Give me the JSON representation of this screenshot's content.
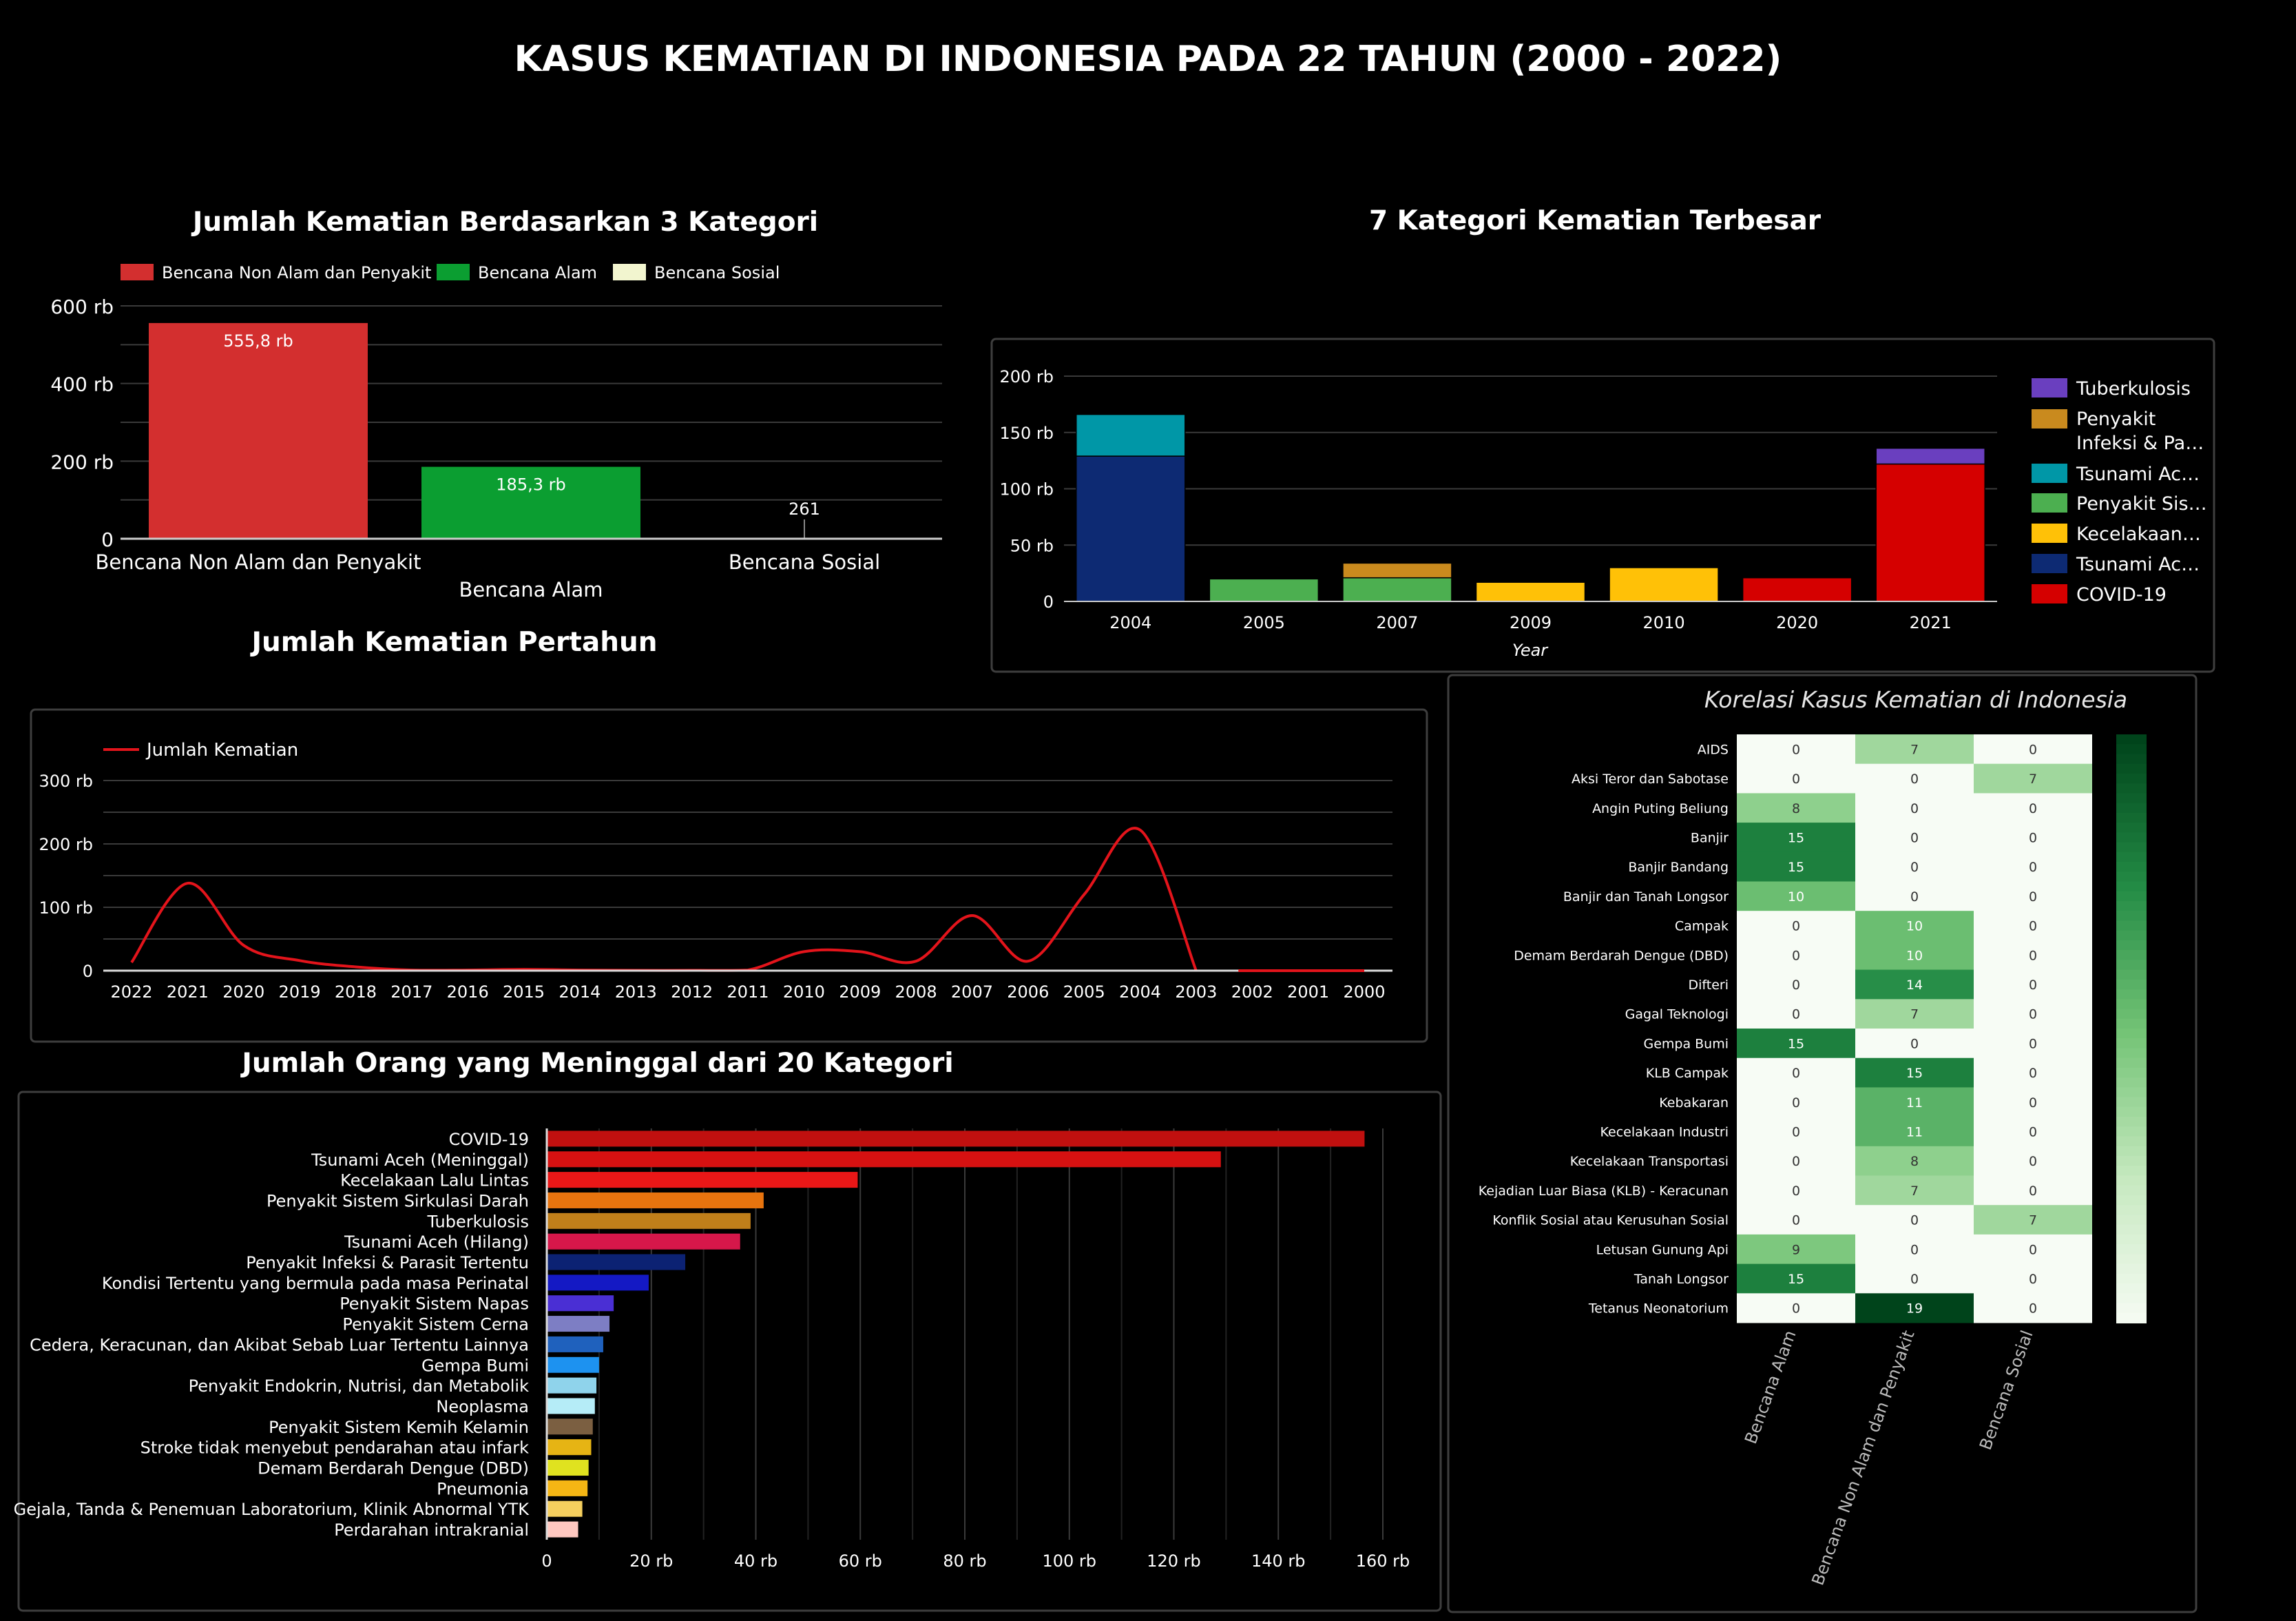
{
  "page_title": "KASUS KEMATIAN DI INDONESIA PADA 22 TAHUN (2000 - 2022)",
  "chart_data": [
    {
      "id": "kategori3",
      "type": "bar",
      "title": "Jumlah Kematian Berdasarkan 3 Kategori",
      "categories": [
        "Bencana Non Alam dan Penyakit",
        "Bencana Alam",
        "Bencana Sosial"
      ],
      "values": [
        555800,
        185300,
        261
      ],
      "value_labels": [
        "555,8 rb",
        "185,3 rb",
        "261"
      ],
      "colors": [
        "#d32f2f",
        "#0b9e31",
        "#f2f5cf"
      ],
      "legend": [
        "Bencana Non Alam dan Penyakit",
        "Bencana Alam",
        "Bencana Sosial"
      ],
      "legend_position": "top-left",
      "ylim": [
        0,
        600000
      ],
      "y_ticks": [
        0,
        200000,
        400000,
        600000
      ],
      "y_tick_labels": [
        "0",
        "200 rb",
        "400 rb",
        "600 rb"
      ],
      "grid": true
    },
    {
      "id": "top7",
      "type": "bar",
      "stacked": true,
      "title": "7 Kategori Kematian Terbesar",
      "xlabel": "Year",
      "categories": [
        "2004",
        "2005",
        "2007",
        "2009",
        "2010",
        "2020",
        "2021"
      ],
      "series": [
        {
          "name": "Tuberkulosis",
          "color": "#6a3fbf",
          "values": [
            0,
            0,
            0,
            0,
            0,
            0,
            14000
          ]
        },
        {
          "name": "Penyakit Infeksi & Pa…",
          "color": "#c98a1e",
          "values": [
            0,
            0,
            13000,
            0,
            0,
            0,
            0
          ]
        },
        {
          "name": "Tsunami Ac…",
          "color": "#0097a7",
          "values": [
            37000,
            0,
            0,
            0,
            0,
            0,
            0
          ]
        },
        {
          "name": "Penyakit Sis…",
          "color": "#4caf50",
          "values": [
            0,
            20000,
            21000,
            0,
            0,
            0,
            0
          ]
        },
        {
          "name": "Kecelakaan…",
          "color": "#ffc107",
          "values": [
            0,
            0,
            0,
            17000,
            30000,
            0,
            0
          ]
        },
        {
          "name": "Tsunami Ac…",
          "color": "#0d2a73",
          "values": [
            129000,
            0,
            0,
            0,
            0,
            0,
            0
          ]
        },
        {
          "name": "COVID-19",
          "color": "#d50000",
          "values": [
            0,
            0,
            0,
            0,
            0,
            21000,
            122000
          ]
        }
      ],
      "legend_order": [
        0,
        1,
        2,
        3,
        4,
        5,
        6
      ],
      "legend_position": "right",
      "ylim": [
        0,
        200000
      ],
      "y_ticks": [
        0,
        50000,
        100000,
        150000,
        200000
      ],
      "y_tick_labels": [
        "0",
        "50 rb",
        "100 rb",
        "150 rb",
        "200 rb"
      ],
      "grid": true
    },
    {
      "id": "pertahun",
      "type": "line",
      "title": "Jumlah Kematian Pertahun",
      "legend": [
        "Jumlah Kematian"
      ],
      "series": [
        {
          "name": "Jumlah Kematian",
          "color": "#e3141b"
        }
      ],
      "x": [
        "2022",
        "2021",
        "2020",
        "2019",
        "2018",
        "2017",
        "2016",
        "2015",
        "2014",
        "2013",
        "2012",
        "2011",
        "2010",
        "2009",
        "2008",
        "2007",
        "2006",
        "2005",
        "2004",
        "2003",
        "2002",
        "2001",
        "2000"
      ],
      "values": [
        13000,
        138000,
        40000,
        16000,
        6000,
        1000,
        1000,
        2000,
        1000,
        500,
        500,
        1000,
        30000,
        30000,
        15000,
        87000,
        15000,
        120000,
        222000,
        0,
        null,
        null,
        null
      ],
      "ylim": [
        0,
        300000
      ],
      "y_ticks": [
        0,
        100000,
        200000,
        300000
      ],
      "y_tick_labels": [
        "0",
        "100 rb",
        "200 rb",
        "300 rb"
      ],
      "grid": true
    },
    {
      "id": "kategori20",
      "type": "bar",
      "orientation": "horizontal",
      "title": "Jumlah Orang yang Meninggal dari 20 Kategori",
      "categories": [
        "COVID-19",
        "Tsunami Aceh (Meninggal)",
        "Kecelakaan Lalu Lintas",
        "Penyakit Sistem Sirkulasi Darah",
        "Tuberkulosis",
        "Tsunami Aceh (Hilang)",
        "Penyakit Infeksi & Parasit Tertentu",
        "Kondisi Tertentu yang bermula pada masa Perinatal",
        "Penyakit Sistem Napas",
        "Penyakit Sistem Cerna",
        "Cedera, Keracunan, dan Akibat Sebab Luar Tertentu Lainnya",
        "Gempa Bumi",
        "Penyakit Endokrin, Nutrisi, dan Metabolik",
        "Neoplasma",
        "Penyakit Sistem Kemih Kelamin",
        "Stroke tidak menyebut pendarahan atau infark",
        "Demam Berdarah Dengue (DBD)",
        "Pneumonia",
        "Gejala, Tanda & Penemuan Laboratorium, Klinik Abnormal YTK",
        "Perdarahan intrakranial"
      ],
      "values": [
        156500,
        129000,
        59500,
        41500,
        39000,
        37000,
        26500,
        19500,
        12800,
        12000,
        10800,
        10000,
        9500,
        9200,
        8800,
        8500,
        8000,
        7800,
        6800,
        6000
      ],
      "colors": [
        "#c0100f",
        "#d61111",
        "#ea1717",
        "#e8740e",
        "#c07f1a",
        "#d6174a",
        "#0c2273",
        "#1419c4",
        "#4a2fd4",
        "#7d7ec4",
        "#1f61bd",
        "#1d92f0",
        "#8fd3eb",
        "#b5ecf7",
        "#7b5f41",
        "#e6b414",
        "#e0e21f",
        "#f5b614",
        "#f5cf5e",
        "#ffc8c0"
      ],
      "xlim": [
        0,
        160000
      ],
      "x_ticks": [
        0,
        20000,
        40000,
        60000,
        80000,
        100000,
        120000,
        140000,
        160000
      ],
      "x_tick_labels": [
        "0",
        "20 rb",
        "40 rb",
        "60 rb",
        "80 rb",
        "100 rb",
        "120 rb",
        "140 rb",
        "160 rb"
      ],
      "grid": true
    },
    {
      "id": "korelasi",
      "type": "heatmap",
      "title": "Korelasi Kasus Kematian di Indonesia",
      "rows": [
        "AIDS",
        "Aksi Teror dan Sabotase",
        "Angin Puting Beliung",
        "Banjir",
        "Banjir Bandang",
        "Banjir dan Tanah Longsor",
        "Campak",
        "Demam Berdarah Dengue (DBD)",
        "Difteri",
        "Gagal Teknologi",
        "Gempa Bumi",
        "KLB Campak",
        "Kebakaran",
        "Kecelakaan Industri",
        "Kecelakaan Transportasi",
        "Kejadian Luar Biasa (KLB) - Keracunan",
        "Konflik Sosial atau Kerusuhan Sosial",
        "Letusan Gunung Api",
        "Tanah Longsor",
        "Tetanus Neonatorium"
      ],
      "columns": [
        "Bencana Alam",
        "Bencana Non Alam dan Penyakit",
        "Bencana Sosial"
      ],
      "values": [
        [
          0,
          7,
          0
        ],
        [
          0,
          0,
          7
        ],
        [
          8,
          0,
          0
        ],
        [
          15,
          0,
          0
        ],
        [
          15,
          0,
          0
        ],
        [
          10,
          0,
          0
        ],
        [
          0,
          10,
          0
        ],
        [
          0,
          10,
          0
        ],
        [
          0,
          14,
          0
        ],
        [
          0,
          7,
          0
        ],
        [
          15,
          0,
          0
        ],
        [
          0,
          15,
          0
        ],
        [
          0,
          11,
          0
        ],
        [
          0,
          11,
          0
        ],
        [
          0,
          8,
          0
        ],
        [
          0,
          7,
          0
        ],
        [
          0,
          0,
          7
        ],
        [
          9,
          0,
          0
        ],
        [
          15,
          0,
          0
        ],
        [
          0,
          19,
          0
        ]
      ],
      "vmin": 0,
      "vmax": 19,
      "colormap": "Greens",
      "colorbar": true
    }
  ]
}
